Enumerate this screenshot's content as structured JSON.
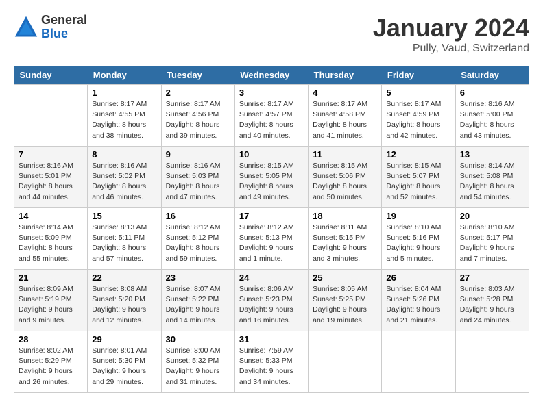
{
  "header": {
    "logo_general": "General",
    "logo_blue": "Blue",
    "month_title": "January 2024",
    "location": "Pully, Vaud, Switzerland"
  },
  "days_of_week": [
    "Sunday",
    "Monday",
    "Tuesday",
    "Wednesday",
    "Thursday",
    "Friday",
    "Saturday"
  ],
  "weeks": [
    [
      {
        "day": "",
        "info": ""
      },
      {
        "day": "1",
        "info": "Sunrise: 8:17 AM\nSunset: 4:55 PM\nDaylight: 8 hours\nand 38 minutes."
      },
      {
        "day": "2",
        "info": "Sunrise: 8:17 AM\nSunset: 4:56 PM\nDaylight: 8 hours\nand 39 minutes."
      },
      {
        "day": "3",
        "info": "Sunrise: 8:17 AM\nSunset: 4:57 PM\nDaylight: 8 hours\nand 40 minutes."
      },
      {
        "day": "4",
        "info": "Sunrise: 8:17 AM\nSunset: 4:58 PM\nDaylight: 8 hours\nand 41 minutes."
      },
      {
        "day": "5",
        "info": "Sunrise: 8:17 AM\nSunset: 4:59 PM\nDaylight: 8 hours\nand 42 minutes."
      },
      {
        "day": "6",
        "info": "Sunrise: 8:16 AM\nSunset: 5:00 PM\nDaylight: 8 hours\nand 43 minutes."
      }
    ],
    [
      {
        "day": "7",
        "info": "Sunrise: 8:16 AM\nSunset: 5:01 PM\nDaylight: 8 hours\nand 44 minutes."
      },
      {
        "day": "8",
        "info": "Sunrise: 8:16 AM\nSunset: 5:02 PM\nDaylight: 8 hours\nand 46 minutes."
      },
      {
        "day": "9",
        "info": "Sunrise: 8:16 AM\nSunset: 5:03 PM\nDaylight: 8 hours\nand 47 minutes."
      },
      {
        "day": "10",
        "info": "Sunrise: 8:15 AM\nSunset: 5:05 PM\nDaylight: 8 hours\nand 49 minutes."
      },
      {
        "day": "11",
        "info": "Sunrise: 8:15 AM\nSunset: 5:06 PM\nDaylight: 8 hours\nand 50 minutes."
      },
      {
        "day": "12",
        "info": "Sunrise: 8:15 AM\nSunset: 5:07 PM\nDaylight: 8 hours\nand 52 minutes."
      },
      {
        "day": "13",
        "info": "Sunrise: 8:14 AM\nSunset: 5:08 PM\nDaylight: 8 hours\nand 54 minutes."
      }
    ],
    [
      {
        "day": "14",
        "info": "Sunrise: 8:14 AM\nSunset: 5:09 PM\nDaylight: 8 hours\nand 55 minutes."
      },
      {
        "day": "15",
        "info": "Sunrise: 8:13 AM\nSunset: 5:11 PM\nDaylight: 8 hours\nand 57 minutes."
      },
      {
        "day": "16",
        "info": "Sunrise: 8:12 AM\nSunset: 5:12 PM\nDaylight: 8 hours\nand 59 minutes."
      },
      {
        "day": "17",
        "info": "Sunrise: 8:12 AM\nSunset: 5:13 PM\nDaylight: 9 hours\nand 1 minute."
      },
      {
        "day": "18",
        "info": "Sunrise: 8:11 AM\nSunset: 5:15 PM\nDaylight: 9 hours\nand 3 minutes."
      },
      {
        "day": "19",
        "info": "Sunrise: 8:10 AM\nSunset: 5:16 PM\nDaylight: 9 hours\nand 5 minutes."
      },
      {
        "day": "20",
        "info": "Sunrise: 8:10 AM\nSunset: 5:17 PM\nDaylight: 9 hours\nand 7 minutes."
      }
    ],
    [
      {
        "day": "21",
        "info": "Sunrise: 8:09 AM\nSunset: 5:19 PM\nDaylight: 9 hours\nand 9 minutes."
      },
      {
        "day": "22",
        "info": "Sunrise: 8:08 AM\nSunset: 5:20 PM\nDaylight: 9 hours\nand 12 minutes."
      },
      {
        "day": "23",
        "info": "Sunrise: 8:07 AM\nSunset: 5:22 PM\nDaylight: 9 hours\nand 14 minutes."
      },
      {
        "day": "24",
        "info": "Sunrise: 8:06 AM\nSunset: 5:23 PM\nDaylight: 9 hours\nand 16 minutes."
      },
      {
        "day": "25",
        "info": "Sunrise: 8:05 AM\nSunset: 5:25 PM\nDaylight: 9 hours\nand 19 minutes."
      },
      {
        "day": "26",
        "info": "Sunrise: 8:04 AM\nSunset: 5:26 PM\nDaylight: 9 hours\nand 21 minutes."
      },
      {
        "day": "27",
        "info": "Sunrise: 8:03 AM\nSunset: 5:28 PM\nDaylight: 9 hours\nand 24 minutes."
      }
    ],
    [
      {
        "day": "28",
        "info": "Sunrise: 8:02 AM\nSunset: 5:29 PM\nDaylight: 9 hours\nand 26 minutes."
      },
      {
        "day": "29",
        "info": "Sunrise: 8:01 AM\nSunset: 5:30 PM\nDaylight: 9 hours\nand 29 minutes."
      },
      {
        "day": "30",
        "info": "Sunrise: 8:00 AM\nSunset: 5:32 PM\nDaylight: 9 hours\nand 31 minutes."
      },
      {
        "day": "31",
        "info": "Sunrise: 7:59 AM\nSunset: 5:33 PM\nDaylight: 9 hours\nand 34 minutes."
      },
      {
        "day": "",
        "info": ""
      },
      {
        "day": "",
        "info": ""
      },
      {
        "day": "",
        "info": ""
      }
    ]
  ]
}
